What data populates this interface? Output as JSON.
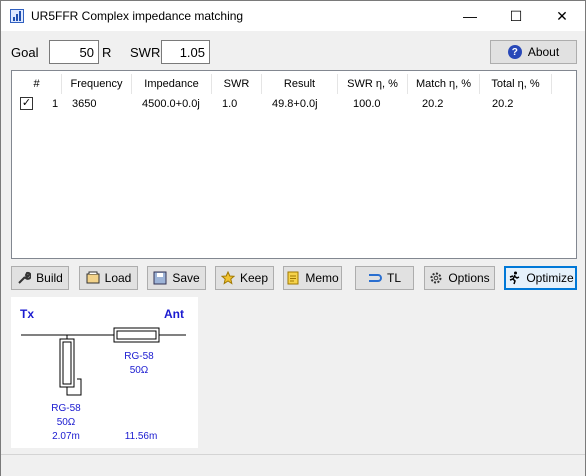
{
  "window": {
    "title": "UR5FFR Complex impedance matching",
    "minimize_glyph": "—",
    "maximize_glyph": "☐",
    "close_glyph": "✕"
  },
  "goal": {
    "label": "Goal",
    "value": "50",
    "unit": "R"
  },
  "swr": {
    "label": "SWR",
    "value": "1.05"
  },
  "about_button": {
    "label": "About",
    "icon": "help-icon"
  },
  "table": {
    "headers": [
      "#",
      "Frequency",
      "Impedance",
      "SWR",
      "Result",
      "SWR η, %",
      "Match η, %",
      "Total η, %"
    ],
    "rows": [
      {
        "checked": true,
        "index": "1",
        "frequency": "3650",
        "impedance": "4500.0+0.0j",
        "swr": "1.0",
        "result": "49.8+0.0j",
        "swr_eff": "100.0",
        "match_eff": "20.2",
        "total_eff": "20.2"
      }
    ]
  },
  "toolbar": {
    "build": "Build",
    "load": "Load",
    "save": "Save",
    "keep": "Keep",
    "memo": "Memo",
    "tl": "TL",
    "options": "Options",
    "optimize": "Optimize"
  },
  "schematic": {
    "tx_label": "Tx",
    "ant_label": "Ant",
    "series_cable": "RG-58",
    "series_impedance": "50Ω",
    "series_length": "11.56m",
    "stub_cable": "RG-58",
    "stub_impedance": "50Ω",
    "stub_length": "2.07m",
    "label_color": "#1a1ad0"
  }
}
